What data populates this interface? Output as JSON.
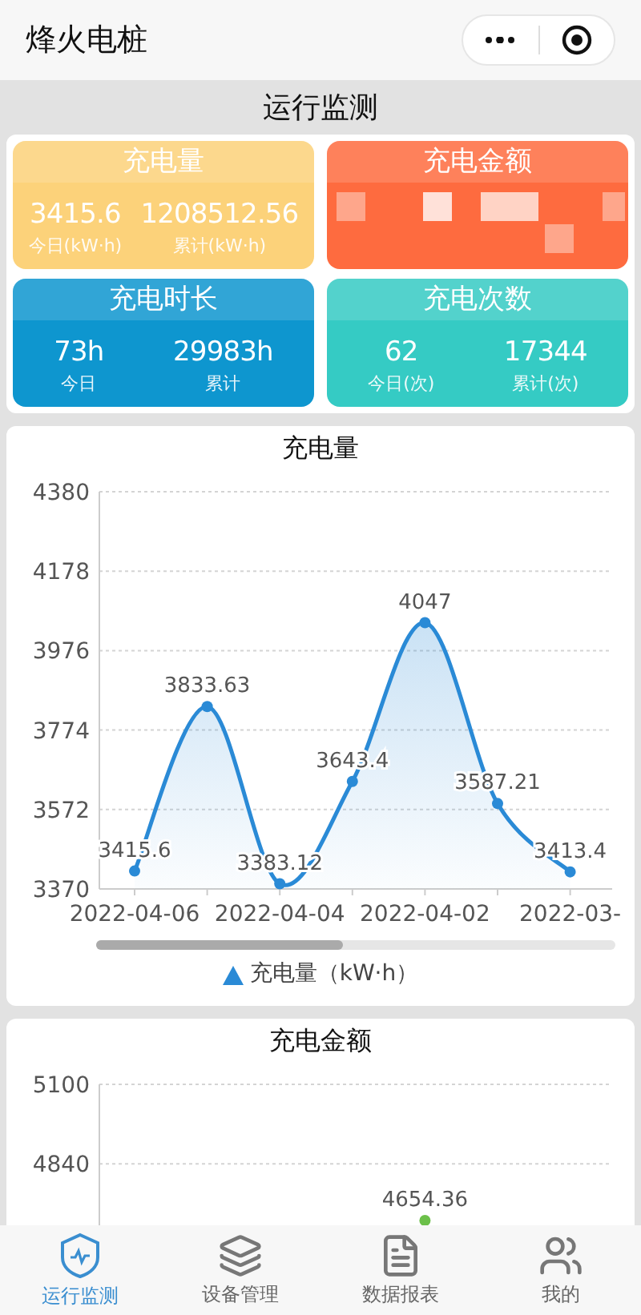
{
  "app_bar": {
    "title": "烽火电桩"
  },
  "page_title": "运行监测",
  "stats": [
    {
      "kind": "stat",
      "title": "充电量",
      "color": "#fcd27a",
      "today": {
        "value": "3415.6",
        "label": "今日(kW·h)"
      },
      "total": {
        "value": "1208512.56",
        "label": "累计(kW·h)"
      }
    },
    {
      "kind": "obscured",
      "title": "充电金额",
      "color": "#fe6b3f"
    },
    {
      "kind": "stat",
      "title": "充电时长",
      "color": "#0e96cf",
      "today": {
        "value": "73h",
        "label": "今日"
      },
      "total": {
        "value": "29983h",
        "label": "累计"
      }
    },
    {
      "kind": "stat",
      "title": "充电次数",
      "color": "#35cbc4",
      "today": {
        "value": "62",
        "label": "今日(次)"
      },
      "total": {
        "value": "17344",
        "label": "累计(次)"
      }
    }
  ],
  "charts": [
    {
      "title": "充电量",
      "chart_data": {
        "type": "area",
        "categories": [
          "2022-04-06",
          null,
          "2022-04-04",
          null,
          "2022-04-02",
          null,
          "2022-03-"
        ],
        "grid": true,
        "yticks": [
          3370,
          3572,
          3774,
          3976,
          4178,
          4380
        ],
        "ylim": [
          3370,
          4380
        ],
        "series": [
          {
            "name": "充电量（kW·h）",
            "color": "#2a8ad6",
            "marker": true,
            "values": [
              3415.6,
              3833.63,
              3383.12,
              3643.4,
              4047,
              3587.21,
              3413.45
            ]
          }
        ],
        "value_labels": [
          "3415.6",
          "3833.63",
          "3383.12",
          "3643.4",
          "4047",
          "3587.21",
          "3413.4"
        ]
      }
    },
    {
      "title": "充电金额",
      "chart_data": {
        "type": "line",
        "categories": [
          null,
          null,
          null,
          null,
          null,
          null,
          null
        ],
        "grid": true,
        "yticks": [
          4840,
          5100
        ],
        "ylim": [
          4580,
          5100
        ],
        "series": [
          {
            "color": "#6cc04a",
            "marker": true,
            "values": [
              null,
              null,
              null,
              null,
              4654.36,
              null,
              null
            ]
          }
        ],
        "value_labels": [
          null,
          null,
          null,
          null,
          "4654.36",
          null,
          null
        ]
      }
    }
  ],
  "nav": [
    {
      "label": "运行监测",
      "selected": true
    },
    {
      "label": "设备管理",
      "selected": false
    },
    {
      "label": "数据报表",
      "selected": false
    },
    {
      "label": "我的",
      "selected": false
    }
  ]
}
